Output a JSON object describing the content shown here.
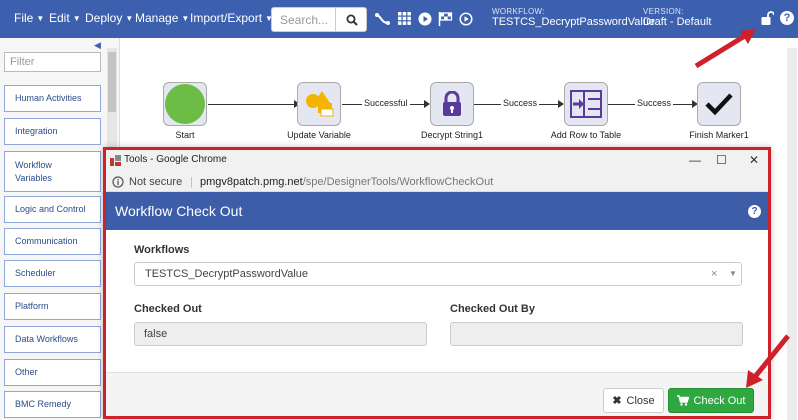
{
  "topbar": {
    "menus": [
      "File",
      "Edit",
      "Deploy",
      "Manage",
      "Import/Export"
    ],
    "search_placeholder": "Search...",
    "workflow_label": "WORKFLOW:",
    "workflow_name": "TESTCS_DecryptPasswordValue",
    "version_label": "VERSION:",
    "version_value": "Draft - Default",
    "icons": [
      "search-icon",
      "connector-icon",
      "grid-icon",
      "play-icon",
      "flag-icon",
      "play-circle-icon",
      "unlock-icon",
      "help-icon"
    ]
  },
  "sidebar": {
    "filter_placeholder": "Filter",
    "categories": [
      "Human Activities",
      "Integration",
      "Workflow Variables",
      "Logic and Control",
      "Communication",
      "Scheduler",
      "Platform",
      "Data Workflows",
      "Other",
      "BMC Remedy"
    ]
  },
  "canvas": {
    "nodes": [
      "Start",
      "Update Variable",
      "Decrypt String1",
      "Add Row to Table",
      "Finish Marker1"
    ],
    "links": [
      "Successful",
      "Success",
      "Success"
    ]
  },
  "browser": {
    "window_title": "Tools - Google Chrome",
    "security": "Not secure",
    "url_host": "pmgv8patch.pmg.net",
    "url_path": "/spe/DesignerTools/WorkflowCheckOut"
  },
  "dialog": {
    "title": "Workflow Check Out",
    "workflows_label": "Workflows",
    "workflows_value": "TESTCS_DecryptPasswordValue",
    "checked_out_label": "Checked Out",
    "checked_out_value": "false",
    "checked_out_by_label": "Checked Out By",
    "checked_out_by_value": "",
    "close_label": "Close",
    "checkout_label": "Check Out"
  },
  "colors": {
    "brand_blue": "#3c60ae",
    "success_green": "#2fa842",
    "highlight_red": "#d0202a"
  }
}
